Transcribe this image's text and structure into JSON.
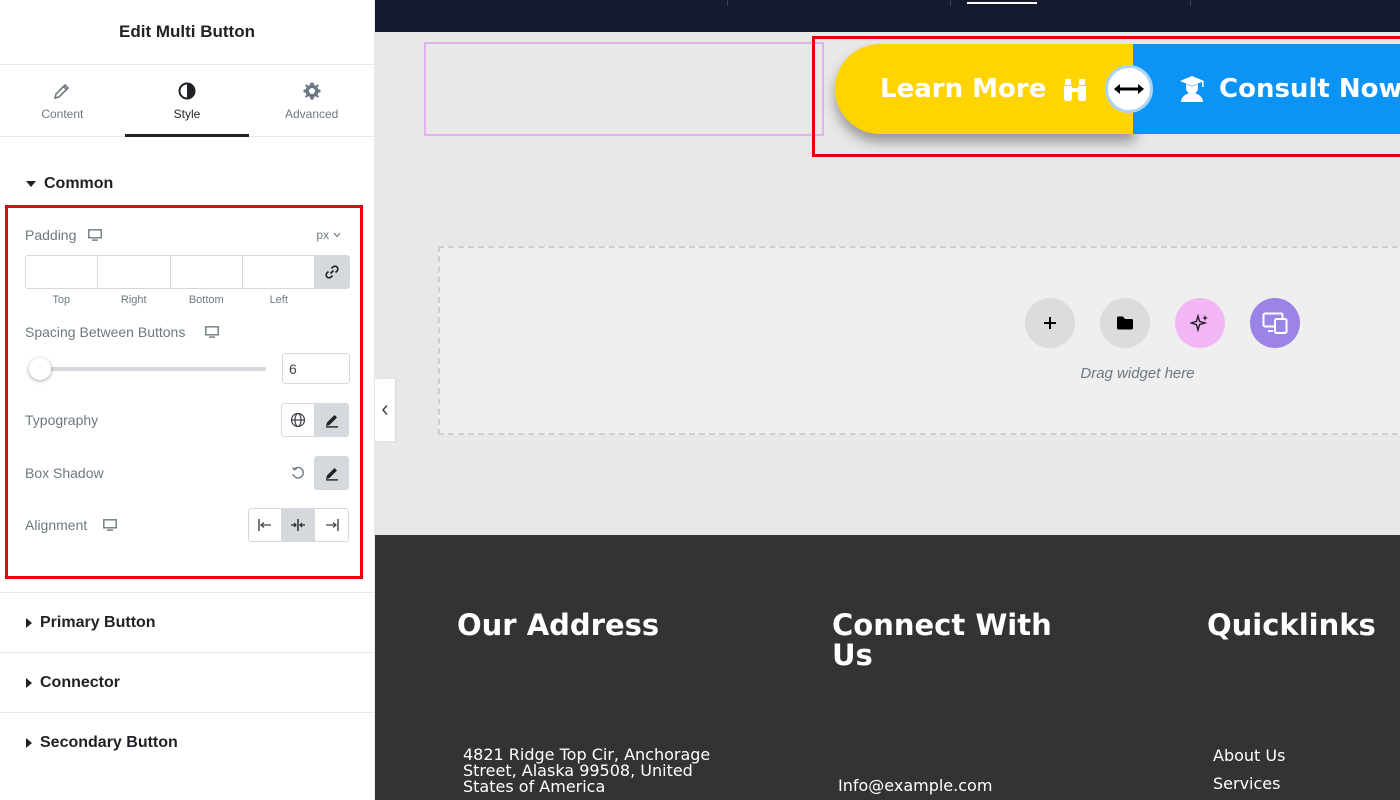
{
  "panel": {
    "title": "Edit Multi Button",
    "tabs": [
      {
        "label": "Content",
        "icon": "pencil-icon"
      },
      {
        "label": "Style",
        "icon": "contrast-icon",
        "active": true
      },
      {
        "label": "Advanced",
        "icon": "gear-icon"
      }
    ],
    "sections": {
      "common": {
        "label": "Common",
        "padding": {
          "label": "Padding",
          "unit": "px",
          "fields": [
            "Top",
            "Right",
            "Bottom",
            "Left"
          ]
        },
        "spacing": {
          "label": "Spacing Between Buttons",
          "value": "6"
        },
        "typography": {
          "label": "Typography"
        },
        "box_shadow": {
          "label": "Box Shadow"
        },
        "alignment": {
          "label": "Alignment",
          "selected": "center"
        }
      },
      "primary": {
        "label": "Primary Button"
      },
      "connector": {
        "label": "Connector"
      },
      "secondary": {
        "label": "Secondary Button"
      }
    }
  },
  "preview": {
    "buttons": {
      "primary": {
        "label": "Learn More",
        "color": "#ffd400",
        "icon": "binoculars-icon"
      },
      "secondary": {
        "label": "Consult Now",
        "color": "#0b93f5",
        "icon": "graduate-icon"
      },
      "connector_icon": "double-arrow-icon"
    },
    "dropzone": {
      "text": "Drag widget here"
    },
    "footer": {
      "address_heading": "Our Address",
      "address_lines": [
        "4821 Ridge Top Cir, Anchorage",
        "Street, Alaska 99508, United",
        "States of America"
      ],
      "connect_heading_1": "Connect With",
      "connect_heading_2": "Us",
      "email": "Info@example.com",
      "quicklinks_heading": "Quicklinks",
      "links": [
        "About Us",
        "Services"
      ]
    }
  },
  "colors": {
    "highlight_red": "#e8000b",
    "footer_bg": "#333333",
    "topbar_bg": "#161a2e"
  }
}
